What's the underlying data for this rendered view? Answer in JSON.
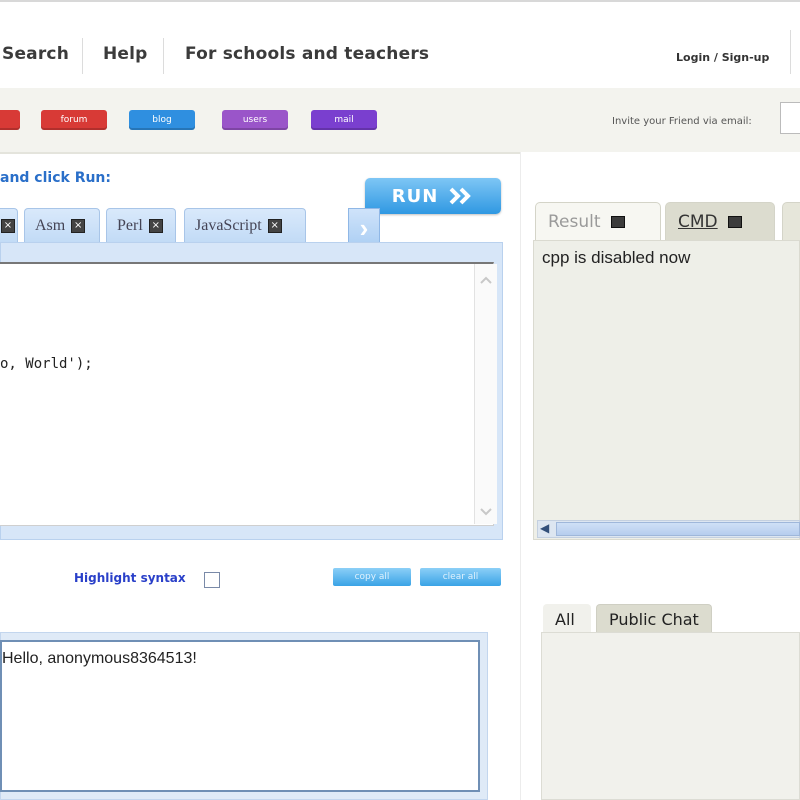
{
  "nav": {
    "links": [
      "Search",
      "Help",
      "For schools and teachers"
    ],
    "login": "Login / Sign-up"
  },
  "toolbar": {
    "pills": [
      {
        "label": "",
        "color": "#d83a36"
      },
      {
        "label": "forum",
        "color": "#d83a36"
      },
      {
        "label": "blog",
        "color": "#2f8fe0"
      },
      {
        "label": "users",
        "color": "#9a55c9"
      },
      {
        "label": "mail",
        "color": "#7a3fcf"
      }
    ],
    "invite_label": "Invite your Friend via email:"
  },
  "editor": {
    "instruction": "and click Run:",
    "run_label": "RUN",
    "tabs": [
      "",
      "Asm",
      "Perl",
      "JavaScript"
    ],
    "code_line": "o, World');"
  },
  "options": {
    "highlight_label": "Highlight syntax",
    "copy_label": "copy all",
    "clear_label": "clear all"
  },
  "output": {
    "text": "Hello, anonymous8364513!"
  },
  "result_panel": {
    "tabs": [
      "Result",
      "CMD"
    ],
    "text": "cpp is disabled now"
  },
  "chat": {
    "tabs": [
      "All",
      "Public Chat"
    ]
  }
}
